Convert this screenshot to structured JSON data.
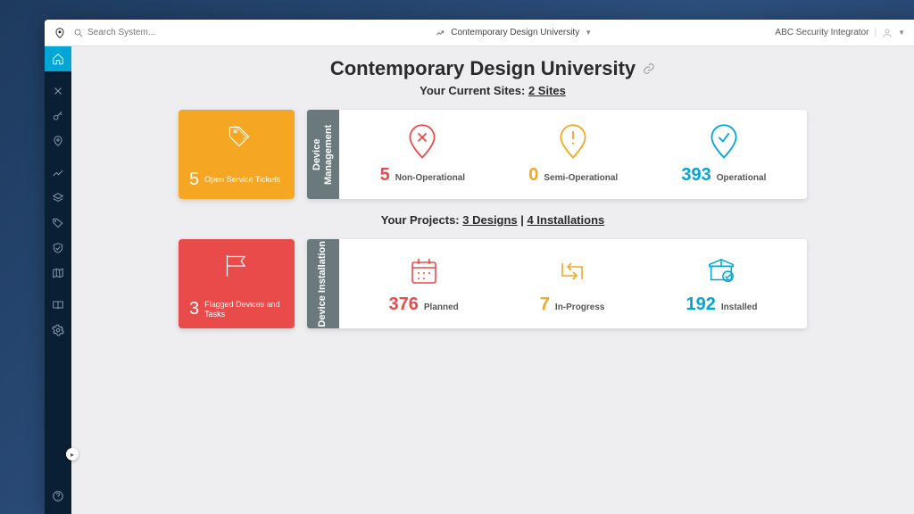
{
  "topbar": {
    "search_placeholder": "Search System...",
    "context_label": "Contemporary Design University",
    "company": "ABC Security Integrator"
  },
  "page": {
    "title": "Contemporary Design University",
    "sites_prefix": "Your Current Sites: ",
    "sites_link": "2 Sites",
    "projects_prefix": "Your Projects: ",
    "projects_designs": "3 Designs",
    "projects_installs": "4 Installations"
  },
  "tiles": {
    "service": {
      "count": "5",
      "label": "Open Service Tickets"
    },
    "flagged": {
      "count": "3",
      "label": "Flagged Devices and Tasks"
    }
  },
  "device_mgmt": {
    "tab": "Device Management",
    "stats": [
      {
        "num": "5",
        "label": "Non-Operational",
        "color": "c-red"
      },
      {
        "num": "0",
        "label": "Semi-Operational",
        "color": "c-orange"
      },
      {
        "num": "393",
        "label": "Operational",
        "color": "c-blue"
      }
    ]
  },
  "device_install": {
    "tab": "Device Installation",
    "stats": [
      {
        "num": "376",
        "label": "Planned",
        "color": "c-red"
      },
      {
        "num": "7",
        "label": "In-Progress",
        "color": "c-orange"
      },
      {
        "num": "192",
        "label": "Installed",
        "color": "c-blue"
      }
    ]
  }
}
